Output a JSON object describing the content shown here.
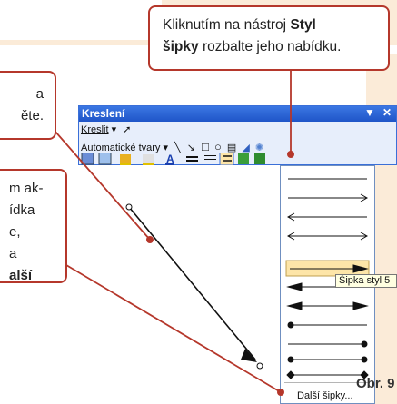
{
  "callouts": {
    "top": {
      "line1_pre": "Kliknutím na nástroj ",
      "line1_bold": "Styl",
      "line2_bold": "šipky",
      "line2_post": " rozbalte jeho nabídku."
    },
    "left_mid": {
      "line1": "a",
      "line2": "ěte."
    },
    "left_bottom": {
      "line1": "m ak-",
      "line2": "ídka",
      "line3": "e,",
      "line4": "a",
      "line5_bold": "alší"
    }
  },
  "figure_label": "Obr. 9",
  "toolbar": {
    "title": "Kreslení",
    "row1_kreslit": "Kreslit",
    "row2_autoshapes": "Automatické tvary"
  },
  "arrow_menu": {
    "items": [
      "line",
      "arrow-right",
      "arrow-left",
      "double-arrow",
      "bold-arrow-right",
      "bold-arrow-left",
      "double-bold-arrow",
      "circle-left",
      "circle-right",
      "circle-both",
      "diamond-both"
    ],
    "selected_index": 4,
    "more_label": "Další šipky...",
    "tooltip": "Šipka styl 5"
  },
  "colors": {
    "accent": "#b5372b",
    "peach": "#fbebd8",
    "titlebar": "#2c63d6"
  }
}
